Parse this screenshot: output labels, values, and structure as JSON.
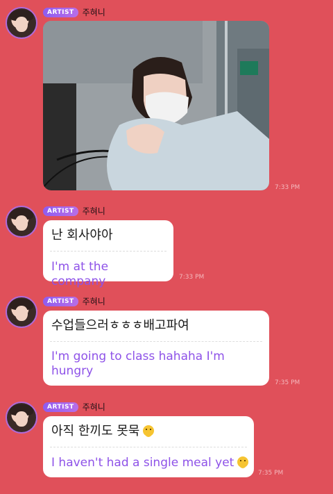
{
  "messages": [
    {
      "badge": "ARTIST",
      "name": "주혀니",
      "type": "photo",
      "photo_icon": "selfie-photo",
      "time": "7:33 PM"
    },
    {
      "badge": "ARTIST",
      "name": "주혀니",
      "type": "text",
      "ko": "난 회사야아",
      "en": "I'm at the company",
      "time": "7:33 PM"
    },
    {
      "badge": "ARTIST",
      "name": "주혀니",
      "type": "text",
      "ko": "수업들으러ㅎㅎㅎ배고파여",
      "en": "I'm going to class hahaha I'm hungry",
      "time": "7:35 PM"
    },
    {
      "badge": "ARTIST",
      "name": "주혀니",
      "type": "text",
      "ko": "아직 한끼도 못묵",
      "en": "I haven't had a single meal yet",
      "emoji": "melting-face-emoji",
      "time": "7:35 PM"
    }
  ],
  "colors": {
    "background": "#e0505a",
    "badge": "#9b5cf0",
    "translation": "#8e52e8"
  }
}
